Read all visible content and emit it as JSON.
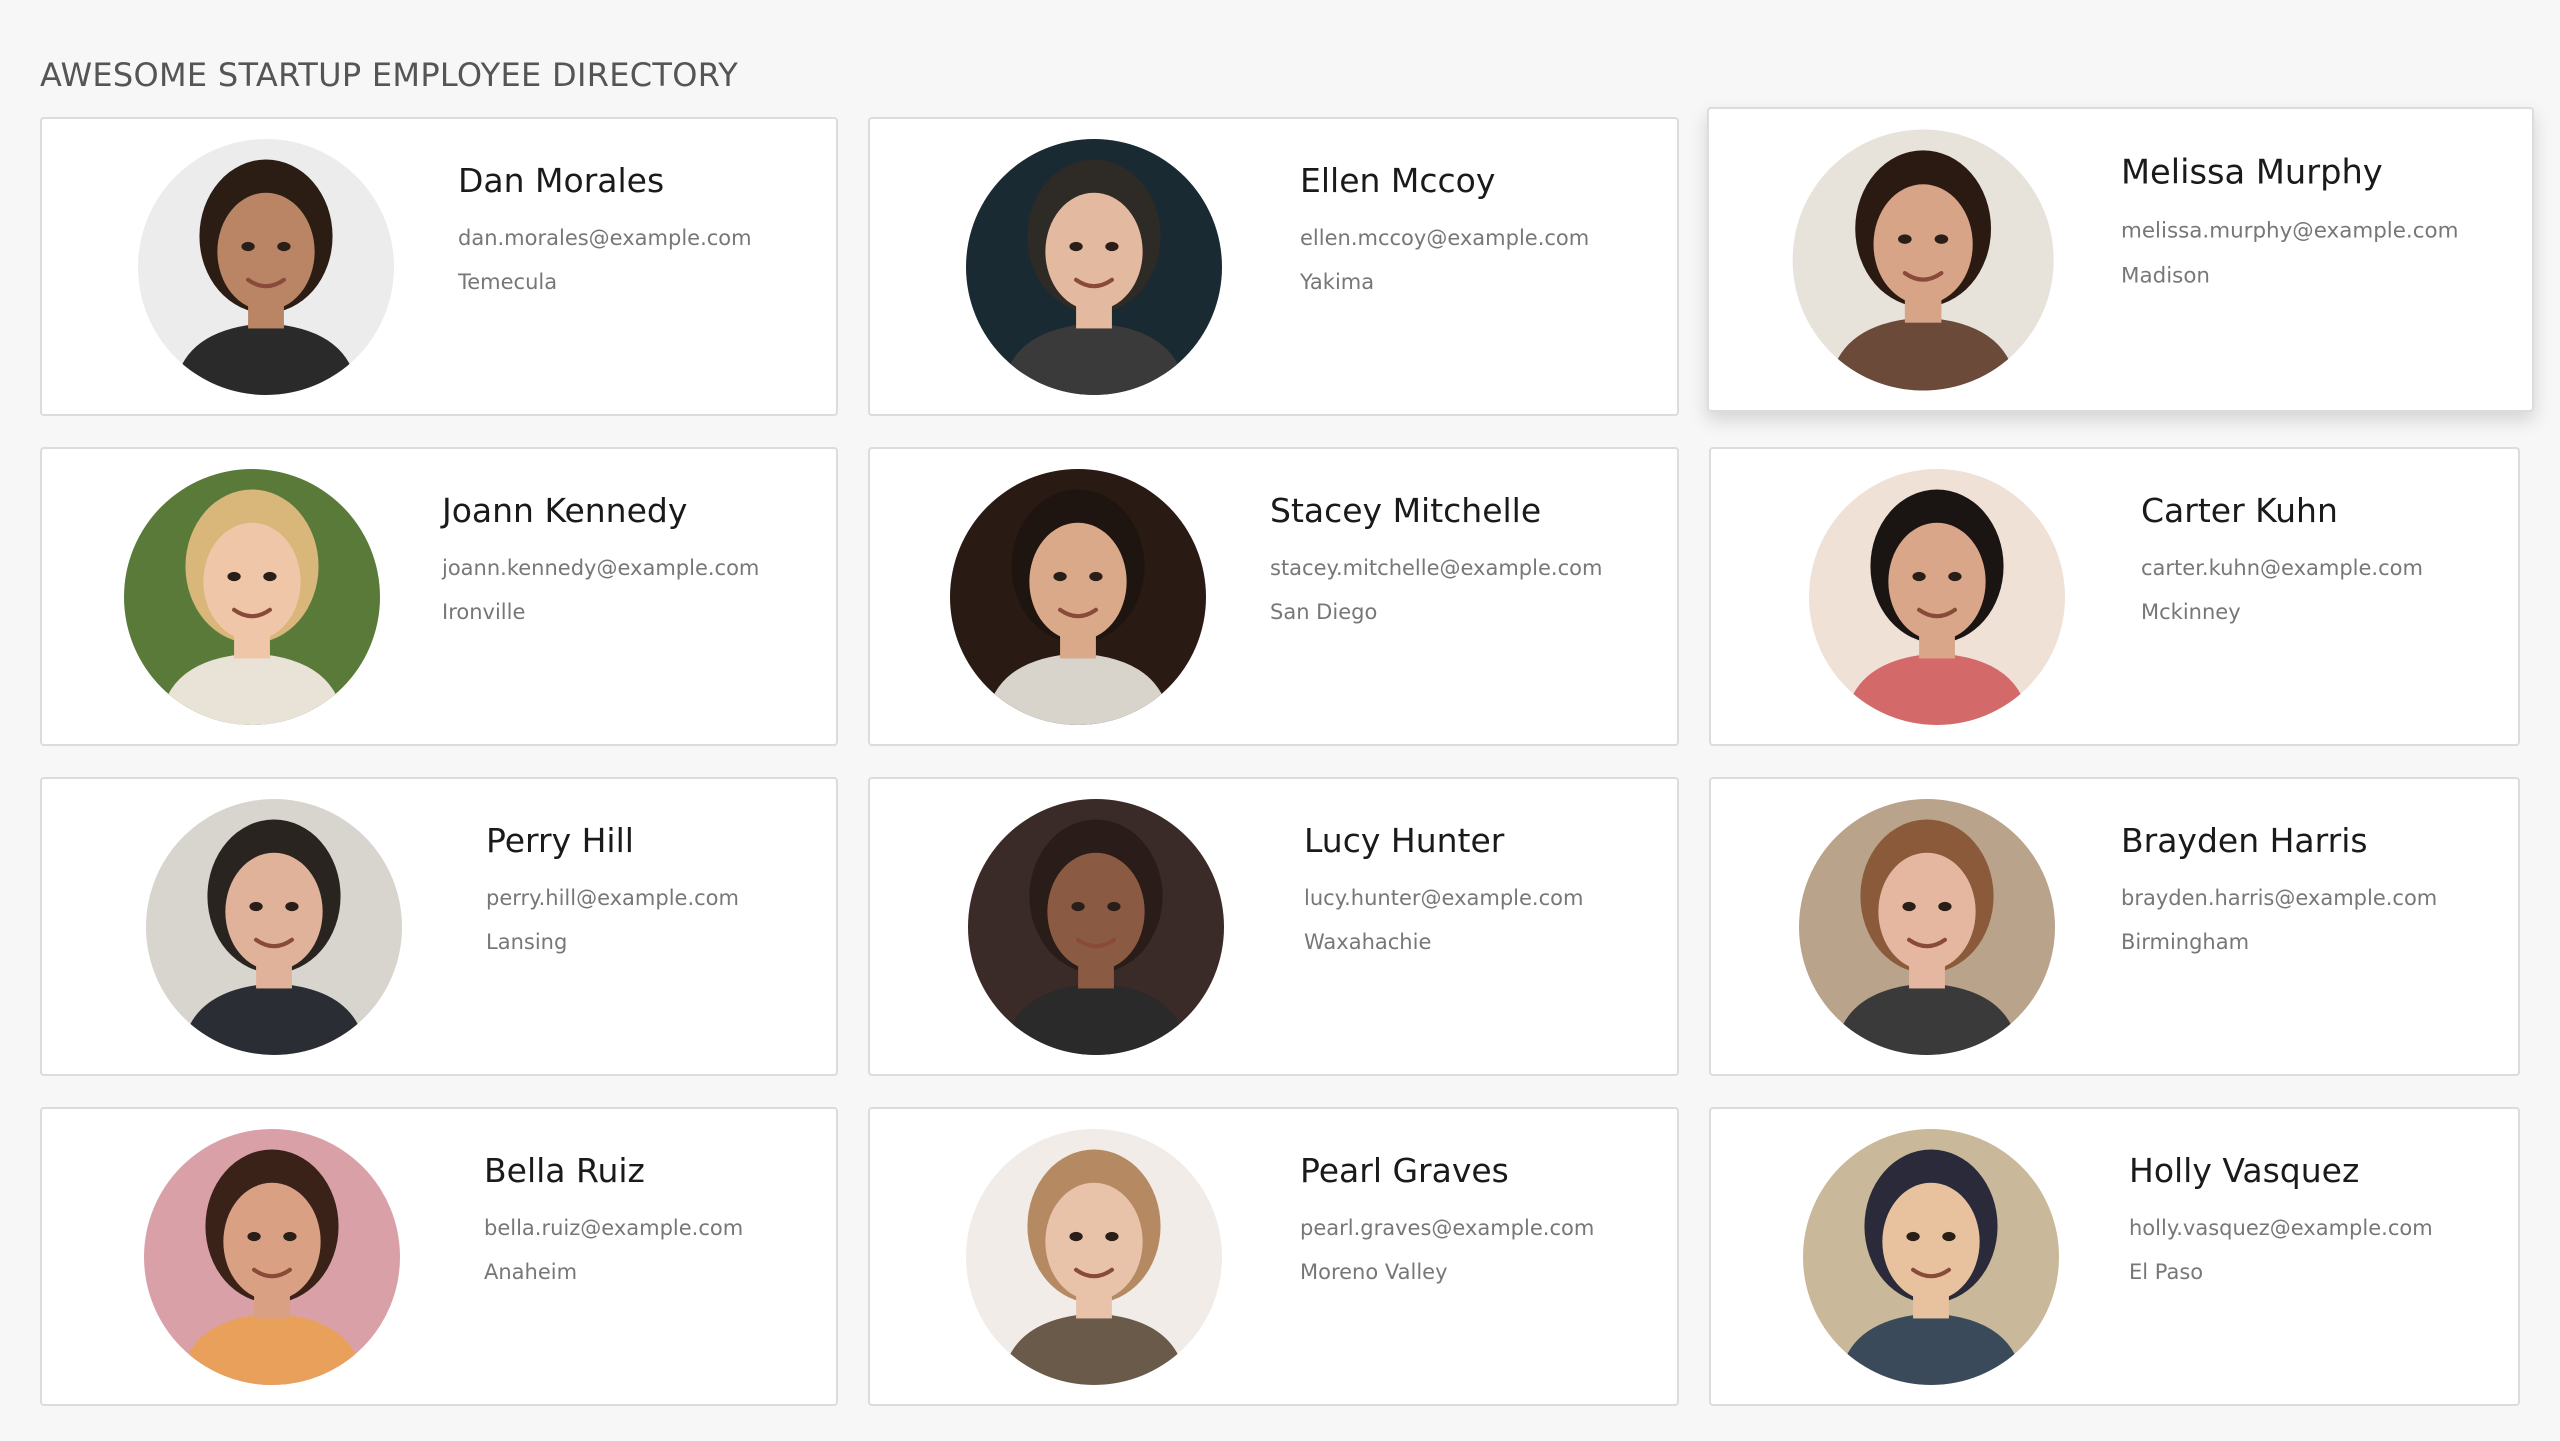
{
  "page": {
    "title": "AWESOME STARTUP EMPLOYEE DIRECTORY"
  },
  "employees": [
    {
      "name": "Dan Morales",
      "email": "dan.morales@example.com",
      "city": "Temecula",
      "skin": "#b98565",
      "hair": "#2b1d14",
      "bg": "#ececec",
      "shirt": "#2a2a2a"
    },
    {
      "name": "Ellen Mccoy",
      "email": "ellen.mccoy@example.com",
      "city": "Yakima",
      "skin": "#e3b9a0",
      "hair": "#2e2a26",
      "bg": "#1a2a33",
      "shirt": "#3a3a3a"
    },
    {
      "name": "Melissa Murphy",
      "email": "melissa.murphy@example.com",
      "city": "Madison",
      "skin": "#d8a487",
      "hair": "#2a1a12",
      "bg": "#e7e2da",
      "shirt": "#6b4a3a"
    },
    {
      "name": "Joann Kennedy",
      "email": "joann.kennedy@example.com",
      "city": "Ironville",
      "skin": "#efc6a8",
      "hair": "#d9b77a",
      "bg": "#5a7a3a",
      "shirt": "#e9e2d6"
    },
    {
      "name": "Stacey Mitchelle",
      "email": "stacey.mitchelle@example.com",
      "city": "San Diego",
      "skin": "#d9a98a",
      "hair": "#1e1410",
      "bg": "#2a1a14",
      "shirt": "#d8d4cc"
    },
    {
      "name": "Carter Kuhn",
      "email": "carter.kuhn@example.com",
      "city": "Mckinney",
      "skin": "#d9a68a",
      "hair": "#1a1412",
      "bg": "#efe1d6",
      "shirt": "#d4696a"
    },
    {
      "name": "Perry Hill",
      "email": "perry.hill@example.com",
      "city": "Lansing",
      "skin": "#e0b29a",
      "hair": "#2a2420",
      "bg": "#d8d4ce",
      "shirt": "#2a2d33"
    },
    {
      "name": "Lucy Hunter",
      "email": "lucy.hunter@example.com",
      "city": "Waxahachie",
      "skin": "#8a5a42",
      "hair": "#2a1c18",
      "bg": "#3a2a28",
      "shirt": "#2a2a2a"
    },
    {
      "name": "Brayden Harris",
      "email": "brayden.harris@example.com",
      "city": "Birmingham",
      "skin": "#e6b7a0",
      "hair": "#8a5a3a",
      "bg": "#b9a38a",
      "shirt": "#3a3a3a"
    },
    {
      "name": "Bella Ruiz",
      "email": "bella.ruiz@example.com",
      "city": "Anaheim",
      "skin": "#d9a084",
      "hair": "#3a2218",
      "bg": "#d9a0a8",
      "shirt": "#e9a05a"
    },
    {
      "name": "Pearl Graves",
      "email": "pearl.graves@example.com",
      "city": "Moreno Valley",
      "skin": "#e9c2aa",
      "hair": "#b58a62",
      "bg": "#f1ece8",
      "shirt": "#6a5a4a"
    },
    {
      "name": "Holly Vasquez",
      "email": "holly.vasquez@example.com",
      "city": "El Paso",
      "skin": "#e8c29e",
      "hair": "#2a2a3a",
      "bg": "#c9b89a",
      "shirt": "#3a4a5a"
    }
  ]
}
